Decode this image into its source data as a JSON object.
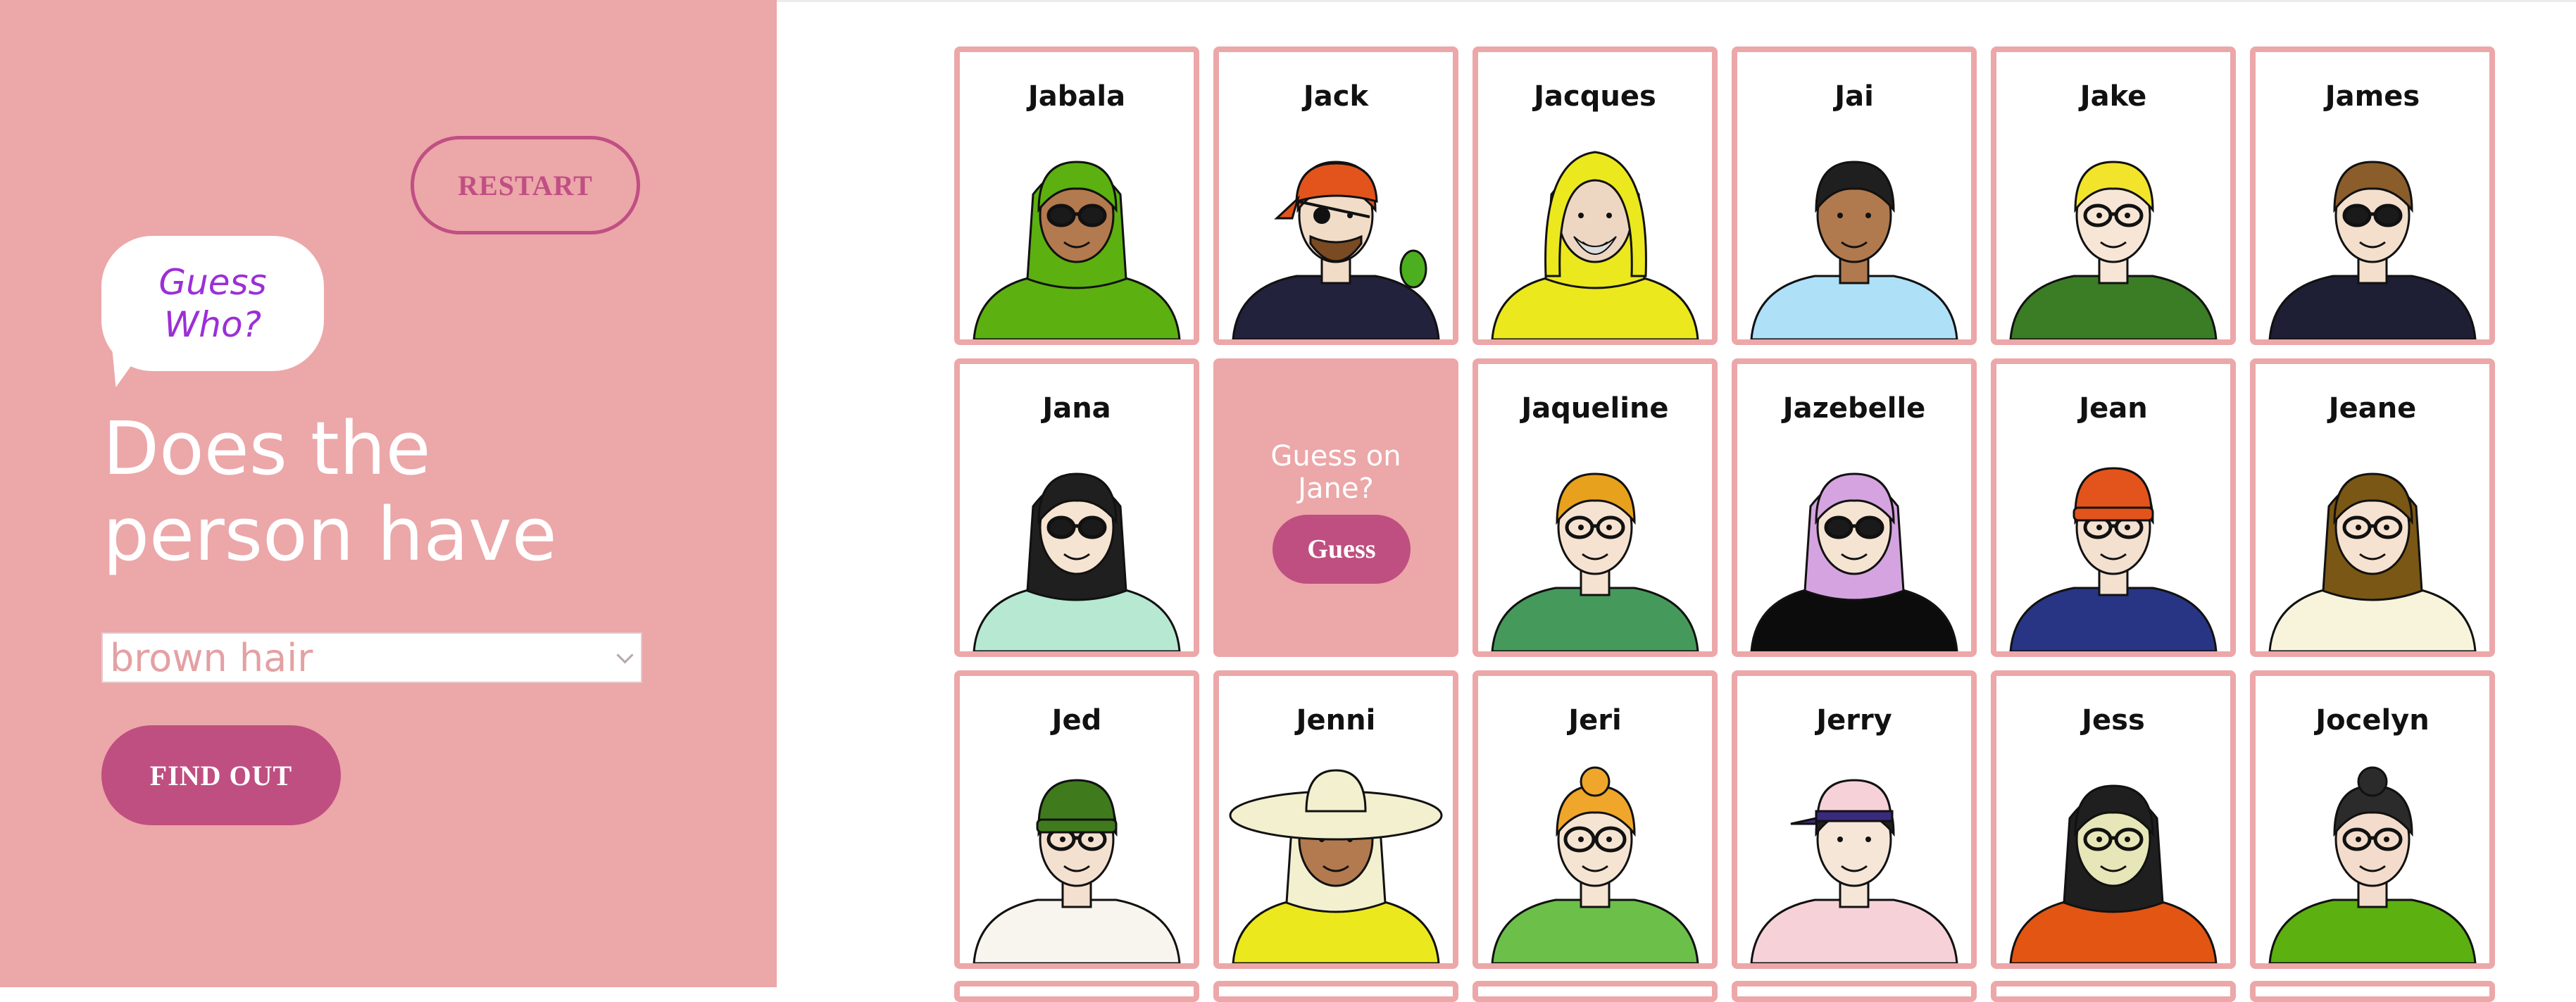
{
  "controls": {
    "restart_label": "RESTART",
    "bubble_text": "Guess Who?",
    "question": "Does the person have",
    "selected_feature": "brown hair",
    "find_out_label": "FIND OUT"
  },
  "board": {
    "cards": [
      {
        "name": "Jabala",
        "skin": "#b27a4e",
        "hair": "#5cb010",
        "shirt": "#5cb010",
        "hat": "",
        "glasses": "sun",
        "eyepatch": false
      },
      {
        "name": "Jack",
        "skin": "#f1dcc8",
        "hair": "#e2541c",
        "shirt": "#23223d",
        "hat": "bandana",
        "glasses": "",
        "eyepatch": true
      },
      {
        "name": "Jacques",
        "skin": "#eed7c2",
        "hair": "#ece81e",
        "shirt": "#ece81e",
        "hat": "hood",
        "glasses": "",
        "eyepatch": false
      },
      {
        "name": "Jai",
        "skin": "#b07a4e",
        "hair": "#1f1f1f",
        "shirt": "#aee0f8",
        "hat": "",
        "glasses": "",
        "eyepatch": false
      },
      {
        "name": "Jake",
        "skin": "#f7e6d6",
        "hair": "#f2e42b",
        "shirt": "#3a7d24",
        "hat": "",
        "glasses": "clear",
        "eyepatch": false
      },
      {
        "name": "James",
        "skin": "#f3dfcc",
        "hair": "#8a5d2b",
        "shirt": "#1e1e34",
        "hat": "",
        "glasses": "sun",
        "eyepatch": false
      },
      {
        "name": "Jana",
        "skin": "#f6e4d2",
        "hair": "#1f1f1f",
        "shirt": "#b6e8d2",
        "hat": "",
        "glasses": "sun",
        "eyepatch": false
      },
      {
        "guess": true,
        "guess_text": "Guess on Jane?",
        "guess_label": "Guess"
      },
      {
        "name": "Jaqueline",
        "skin": "#f6e2d0",
        "hair": "#e8a11c",
        "shirt": "#459a5b",
        "hat": "",
        "glasses": "clear",
        "eyepatch": false
      },
      {
        "name": "Jazebelle",
        "skin": "#f6e4d3",
        "hair": "#d5a4e0",
        "shirt": "#0c0c0c",
        "hat": "",
        "glasses": "sun",
        "eyepatch": false
      },
      {
        "name": "Jean",
        "skin": "#f4e0cf",
        "hair": "#e2541c",
        "shirt": "#283585",
        "hat": "beanie",
        "glasses": "clear",
        "eyepatch": false
      },
      {
        "name": "Jeane",
        "skin": "#f6e2d0",
        "hair": "#7a5714",
        "shirt": "#f8f4dc",
        "hat": "",
        "glasses": "clear",
        "eyepatch": false
      },
      {
        "name": "Jed",
        "skin": "#f4e0cf",
        "hair": "#e79a2a",
        "shirt": "#f8f4ee",
        "hat": "beanie-green",
        "glasses": "clear",
        "eyepatch": false
      },
      {
        "name": "Jenni",
        "skin": "#b27a4e",
        "hair": "#f2f0cf",
        "shirt": "#ece81e",
        "hat": "sunhat",
        "glasses": "",
        "eyepatch": false
      },
      {
        "name": "Jeri",
        "skin": "#f6e4d2",
        "hair": "#f0a62a",
        "shirt": "#6cc04a",
        "hat": "",
        "glasses": "round",
        "eyepatch": false
      },
      {
        "name": "Jerry",
        "skin": "#f6e6d8",
        "hair": "#1f1f1f",
        "shirt": "#f6d2d8",
        "hat": "cap",
        "glasses": "",
        "eyepatch": false
      },
      {
        "name": "Jess",
        "skin": "#e6e6b8",
        "hair": "#1f1f1f",
        "shirt": "#e25512",
        "hat": "",
        "glasses": "clear",
        "eyepatch": false
      },
      {
        "name": "Jocelyn",
        "skin": "#f3dccb",
        "hair": "#2b2b2b",
        "shirt": "#5cb010",
        "hat": "",
        "glasses": "clear",
        "eyepatch": false
      }
    ]
  }
}
